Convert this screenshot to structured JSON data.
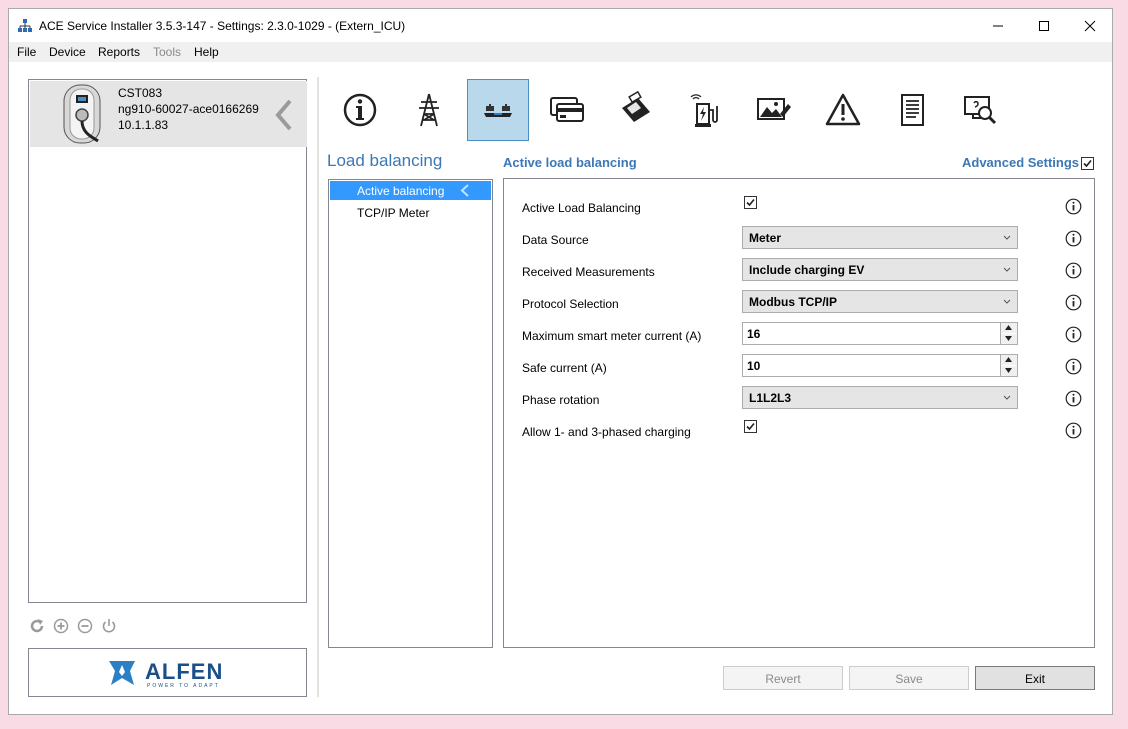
{
  "window": {
    "title": "ACE Service Installer 3.5.3-147 - Settings: 2.3.0-1029 -  (Extern_ICU)"
  },
  "menu": {
    "items": [
      {
        "label": "File",
        "enabled": true
      },
      {
        "label": "Device",
        "enabled": true
      },
      {
        "label": "Reports",
        "enabled": true
      },
      {
        "label": "Tools",
        "enabled": false
      },
      {
        "label": "Help",
        "enabled": true
      }
    ]
  },
  "device": {
    "name": "CST083",
    "serial": "ng910-60027-ace0166269",
    "ip": "10.1.1.83"
  },
  "toolbar": {
    "icons": [
      "info-icon",
      "power-tower-icon",
      "load-balancing-scale-icon",
      "payment-cards-icon",
      "card-terminal-icon",
      "charging-station-icon",
      "display-image-icon",
      "warning-icon",
      "document-icon",
      "diagnostics-monitor-icon"
    ],
    "active": "load-balancing-scale-icon"
  },
  "section": {
    "title": "Load balancing"
  },
  "nav": {
    "items": [
      {
        "label": "Active balancing",
        "selected": true
      },
      {
        "label": "TCP/IP Meter",
        "selected": false
      }
    ]
  },
  "subsection": {
    "title": "Active load balancing",
    "advanced_label": "Advanced Settings",
    "advanced_checked": true
  },
  "settings": {
    "active_load_balancing": {
      "label": "Active Load Balancing",
      "checked": true
    },
    "data_source": {
      "label": "Data Source",
      "value": "Meter"
    },
    "received_measurements": {
      "label": "Received Measurements",
      "value": "Include charging EV"
    },
    "protocol_selection": {
      "label": "Protocol Selection",
      "value": "Modbus TCP/IP"
    },
    "max_meter_current": {
      "label": "Maximum smart meter current (A)",
      "value": "16"
    },
    "safe_current": {
      "label": "Safe current (A)",
      "value": "10"
    },
    "phase_rotation": {
      "label": "Phase rotation",
      "value": "L1L2L3"
    },
    "allow_phased_charging": {
      "label": "Allow 1- and 3-phased charging",
      "checked": true
    }
  },
  "buttons": {
    "revert": "Revert",
    "save": "Save",
    "exit": "Exit"
  },
  "brand": {
    "name": "ALFEN",
    "tagline": "POWER TO ADAPT",
    "color": "#1a4f8a"
  },
  "colors": {
    "accent": "#3c78b5",
    "selection": "#3399ff",
    "active_tool_bg": "#b9d8ec"
  }
}
